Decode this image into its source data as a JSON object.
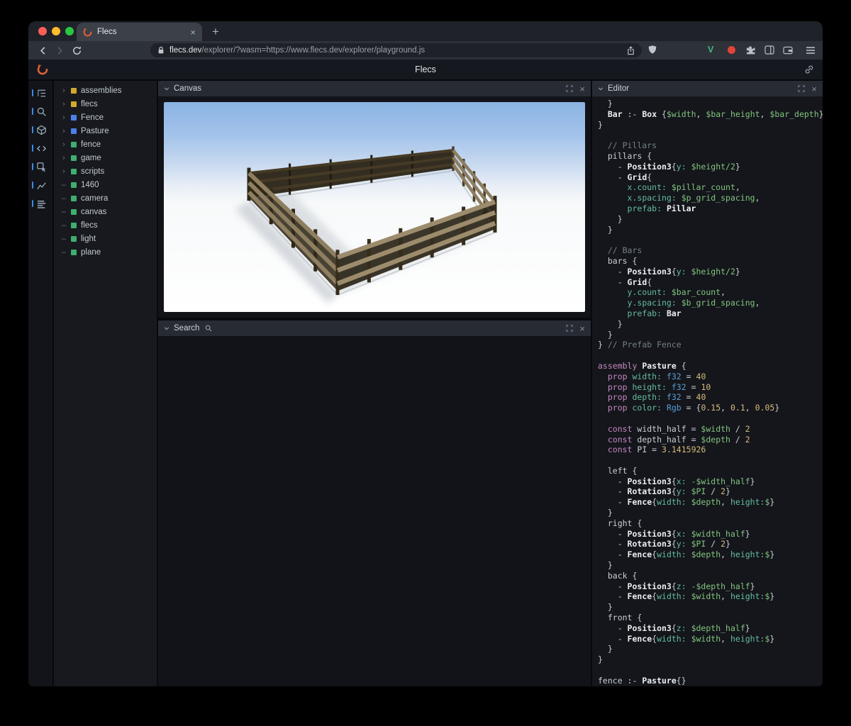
{
  "browser": {
    "tab": {
      "title": "Flecs"
    },
    "url": {
      "domain": "flecs.dev",
      "path": "/explorer/?wasm=https://www.flecs.dev/explorer/playground.js"
    },
    "extensions": {
      "v_label": "V"
    }
  },
  "app": {
    "title": "Flecs"
  },
  "panels": {
    "canvas": {
      "title": "Canvas"
    },
    "search": {
      "title": "Search"
    },
    "editor": {
      "title": "Editor"
    }
  },
  "tree": {
    "items": [
      {
        "label": "assemblies",
        "marker": "expand",
        "color": "#d0aa2e"
      },
      {
        "label": "flecs",
        "marker": "expand",
        "color": "#d0aa2e"
      },
      {
        "label": "Fence",
        "marker": "expand",
        "color": "#4d7fe8"
      },
      {
        "label": "Pasture",
        "marker": "expand",
        "color": "#4d7fe8"
      },
      {
        "label": "fence",
        "marker": "expand",
        "color": "#3fae6e"
      },
      {
        "label": "game",
        "marker": "expand",
        "color": "#3fae6e"
      },
      {
        "label": "scripts",
        "marker": "expand",
        "color": "#3fae6e"
      },
      {
        "label": "1460",
        "marker": "leaf",
        "color": "#3fae6e"
      },
      {
        "label": "camera",
        "marker": "leaf",
        "color": "#3fae6e"
      },
      {
        "label": "canvas",
        "marker": "leaf",
        "color": "#3fae6e"
      },
      {
        "label": "flecs",
        "marker": "leaf",
        "color": "#3fae6e"
      },
      {
        "label": "light",
        "marker": "leaf",
        "color": "#3fae6e"
      },
      {
        "label": "plane",
        "marker": "leaf",
        "color": "#3fae6e"
      }
    ]
  },
  "code": {
    "lines": [
      [
        [
          "pl",
          "  }"
        ]
      ],
      [
        [
          "pl",
          "  "
        ],
        [
          "bd",
          "Bar"
        ],
        [
          "pl",
          " :- "
        ],
        [
          "bd",
          "Box"
        ],
        [
          "pl",
          " {"
        ],
        [
          "vr",
          "$width"
        ],
        [
          "pl",
          ", "
        ],
        [
          "vr",
          "$bar_height"
        ],
        [
          "pl",
          ", "
        ],
        [
          "vr",
          "$bar_depth"
        ],
        [
          "pl",
          "}"
        ]
      ],
      [
        [
          "pl",
          "}"
        ]
      ],
      [],
      [
        [
          "cm",
          "  // Pillars"
        ]
      ],
      [
        [
          "pl",
          "  pillars {"
        ]
      ],
      [
        [
          "pl",
          "    - "
        ],
        [
          "bd",
          "Position3"
        ],
        [
          "pl",
          "{"
        ],
        [
          "ky",
          "y: "
        ],
        [
          "vr",
          "$height/2"
        ],
        [
          "pl",
          "}"
        ]
      ],
      [
        [
          "pl",
          "    - "
        ],
        [
          "bd",
          "Grid"
        ],
        [
          "pl",
          "{"
        ]
      ],
      [
        [
          "pl",
          "      "
        ],
        [
          "ky",
          "x.count: "
        ],
        [
          "vr",
          "$pillar_count"
        ],
        [
          "pl",
          ","
        ]
      ],
      [
        [
          "pl",
          "      "
        ],
        [
          "ky",
          "x.spacing: "
        ],
        [
          "vr",
          "$p_grid_spacing"
        ],
        [
          "pl",
          ","
        ]
      ],
      [
        [
          "pl",
          "      "
        ],
        [
          "ky",
          "prefab: "
        ],
        [
          "bd",
          "Pillar"
        ]
      ],
      [
        [
          "pl",
          "    }"
        ]
      ],
      [
        [
          "pl",
          "  }"
        ]
      ],
      [],
      [
        [
          "cm",
          "  // Bars"
        ]
      ],
      [
        [
          "pl",
          "  bars {"
        ]
      ],
      [
        [
          "pl",
          "    - "
        ],
        [
          "bd",
          "Position3"
        ],
        [
          "pl",
          "{"
        ],
        [
          "ky",
          "y: "
        ],
        [
          "vr",
          "$height/2"
        ],
        [
          "pl",
          "}"
        ]
      ],
      [
        [
          "pl",
          "    - "
        ],
        [
          "bd",
          "Grid"
        ],
        [
          "pl",
          "{"
        ]
      ],
      [
        [
          "pl",
          "      "
        ],
        [
          "ky",
          "y.count: "
        ],
        [
          "vr",
          "$bar_count"
        ],
        [
          "pl",
          ","
        ]
      ],
      [
        [
          "pl",
          "      "
        ],
        [
          "ky",
          "y.spacing: "
        ],
        [
          "vr",
          "$b_grid_spacing"
        ],
        [
          "pl",
          ","
        ]
      ],
      [
        [
          "pl",
          "      "
        ],
        [
          "ky",
          "prefab: "
        ],
        [
          "bd",
          "Bar"
        ]
      ],
      [
        [
          "pl",
          "    }"
        ]
      ],
      [
        [
          "pl",
          "  }"
        ]
      ],
      [
        [
          "pl",
          "} "
        ],
        [
          "cm",
          "// Prefab Fence"
        ]
      ],
      [],
      [
        [
          "kw",
          "assembly "
        ],
        [
          "bd",
          "Pasture"
        ],
        [
          "pl",
          " {"
        ]
      ],
      [
        [
          "pl",
          "  "
        ],
        [
          "kw",
          "prop "
        ],
        [
          "ky",
          "width: "
        ],
        [
          "ty",
          "f32"
        ],
        [
          "pl",
          " = "
        ],
        [
          "nm",
          "40"
        ]
      ],
      [
        [
          "pl",
          "  "
        ],
        [
          "kw",
          "prop "
        ],
        [
          "ky",
          "height: "
        ],
        [
          "ty",
          "f32"
        ],
        [
          "pl",
          " = "
        ],
        [
          "nm",
          "10"
        ]
      ],
      [
        [
          "pl",
          "  "
        ],
        [
          "kw",
          "prop "
        ],
        [
          "ky",
          "depth: "
        ],
        [
          "ty",
          "f32"
        ],
        [
          "pl",
          " = "
        ],
        [
          "nm",
          "40"
        ]
      ],
      [
        [
          "pl",
          "  "
        ],
        [
          "kw",
          "prop "
        ],
        [
          "ky",
          "color: "
        ],
        [
          "ty",
          "Rgb"
        ],
        [
          "pl",
          " = {"
        ],
        [
          "nm",
          "0.15"
        ],
        [
          "pl",
          ", "
        ],
        [
          "nm",
          "0.1"
        ],
        [
          "pl",
          ", "
        ],
        [
          "nm",
          "0.05"
        ],
        [
          "pl",
          "}"
        ]
      ],
      [],
      [
        [
          "pl",
          "  "
        ],
        [
          "kw",
          "const "
        ],
        [
          "pl",
          "width_half = "
        ],
        [
          "vr",
          "$width"
        ],
        [
          "pl",
          " / "
        ],
        [
          "nm",
          "2"
        ]
      ],
      [
        [
          "pl",
          "  "
        ],
        [
          "kw",
          "const "
        ],
        [
          "pl",
          "depth_half = "
        ],
        [
          "vr",
          "$depth"
        ],
        [
          "pl",
          " / "
        ],
        [
          "nm",
          "2"
        ]
      ],
      [
        [
          "pl",
          "  "
        ],
        [
          "kw",
          "const "
        ],
        [
          "pl",
          "PI = "
        ],
        [
          "nm",
          "3.1415926"
        ]
      ],
      [],
      [
        [
          "pl",
          "  left {"
        ]
      ],
      [
        [
          "pl",
          "    - "
        ],
        [
          "bd",
          "Position3"
        ],
        [
          "pl",
          "{"
        ],
        [
          "ky",
          "x: "
        ],
        [
          "vr",
          "-$width_half"
        ],
        [
          "pl",
          "}"
        ]
      ],
      [
        [
          "pl",
          "    - "
        ],
        [
          "bd",
          "Rotation3"
        ],
        [
          "pl",
          "{"
        ],
        [
          "ky",
          "y: "
        ],
        [
          "vr",
          "$PI"
        ],
        [
          "pl",
          " / "
        ],
        [
          "nm",
          "2"
        ],
        [
          "pl",
          "}"
        ]
      ],
      [
        [
          "pl",
          "    - "
        ],
        [
          "bd",
          "Fence"
        ],
        [
          "pl",
          "{"
        ],
        [
          "ky",
          "width: "
        ],
        [
          "vr",
          "$depth"
        ],
        [
          "pl",
          ", "
        ],
        [
          "ky",
          "height:"
        ],
        [
          "vr",
          "$"
        ],
        [
          "pl",
          "}"
        ]
      ],
      [
        [
          "pl",
          "  }"
        ]
      ],
      [
        [
          "pl",
          "  right {"
        ]
      ],
      [
        [
          "pl",
          "    - "
        ],
        [
          "bd",
          "Position3"
        ],
        [
          "pl",
          "{"
        ],
        [
          "ky",
          "x: "
        ],
        [
          "vr",
          "$width_half"
        ],
        [
          "pl",
          "}"
        ]
      ],
      [
        [
          "pl",
          "    - "
        ],
        [
          "bd",
          "Rotation3"
        ],
        [
          "pl",
          "{"
        ],
        [
          "ky",
          "y: "
        ],
        [
          "vr",
          "$PI"
        ],
        [
          "pl",
          " / "
        ],
        [
          "nm",
          "2"
        ],
        [
          "pl",
          "}"
        ]
      ],
      [
        [
          "pl",
          "    - "
        ],
        [
          "bd",
          "Fence"
        ],
        [
          "pl",
          "{"
        ],
        [
          "ky",
          "width: "
        ],
        [
          "vr",
          "$depth"
        ],
        [
          "pl",
          ", "
        ],
        [
          "ky",
          "height:"
        ],
        [
          "vr",
          "$"
        ],
        [
          "pl",
          "}"
        ]
      ],
      [
        [
          "pl",
          "  }"
        ]
      ],
      [
        [
          "pl",
          "  back {"
        ]
      ],
      [
        [
          "pl",
          "    - "
        ],
        [
          "bd",
          "Position3"
        ],
        [
          "pl",
          "{"
        ],
        [
          "ky",
          "z: "
        ],
        [
          "vr",
          "-$depth_half"
        ],
        [
          "pl",
          "}"
        ]
      ],
      [
        [
          "pl",
          "    - "
        ],
        [
          "bd",
          "Fence"
        ],
        [
          "pl",
          "{"
        ],
        [
          "ky",
          "width: "
        ],
        [
          "vr",
          "$width"
        ],
        [
          "pl",
          ", "
        ],
        [
          "ky",
          "height:"
        ],
        [
          "vr",
          "$"
        ],
        [
          "pl",
          "}"
        ]
      ],
      [
        [
          "pl",
          "  }"
        ]
      ],
      [
        [
          "pl",
          "  front {"
        ]
      ],
      [
        [
          "pl",
          "    - "
        ],
        [
          "bd",
          "Position3"
        ],
        [
          "pl",
          "{"
        ],
        [
          "ky",
          "z: "
        ],
        [
          "vr",
          "$depth_half"
        ],
        [
          "pl",
          "}"
        ]
      ],
      [
        [
          "pl",
          "    - "
        ],
        [
          "bd",
          "Fence"
        ],
        [
          "pl",
          "{"
        ],
        [
          "ky",
          "width: "
        ],
        [
          "vr",
          "$width"
        ],
        [
          "pl",
          ", "
        ],
        [
          "ky",
          "height:"
        ],
        [
          "vr",
          "$"
        ],
        [
          "pl",
          "}"
        ]
      ],
      [
        [
          "pl",
          "  }"
        ]
      ],
      [
        [
          "pl",
          "}"
        ]
      ],
      [],
      [
        [
          "pl",
          "fence :- "
        ],
        [
          "bd",
          "Pasture"
        ],
        [
          "pl",
          "{}"
        ]
      ]
    ]
  }
}
